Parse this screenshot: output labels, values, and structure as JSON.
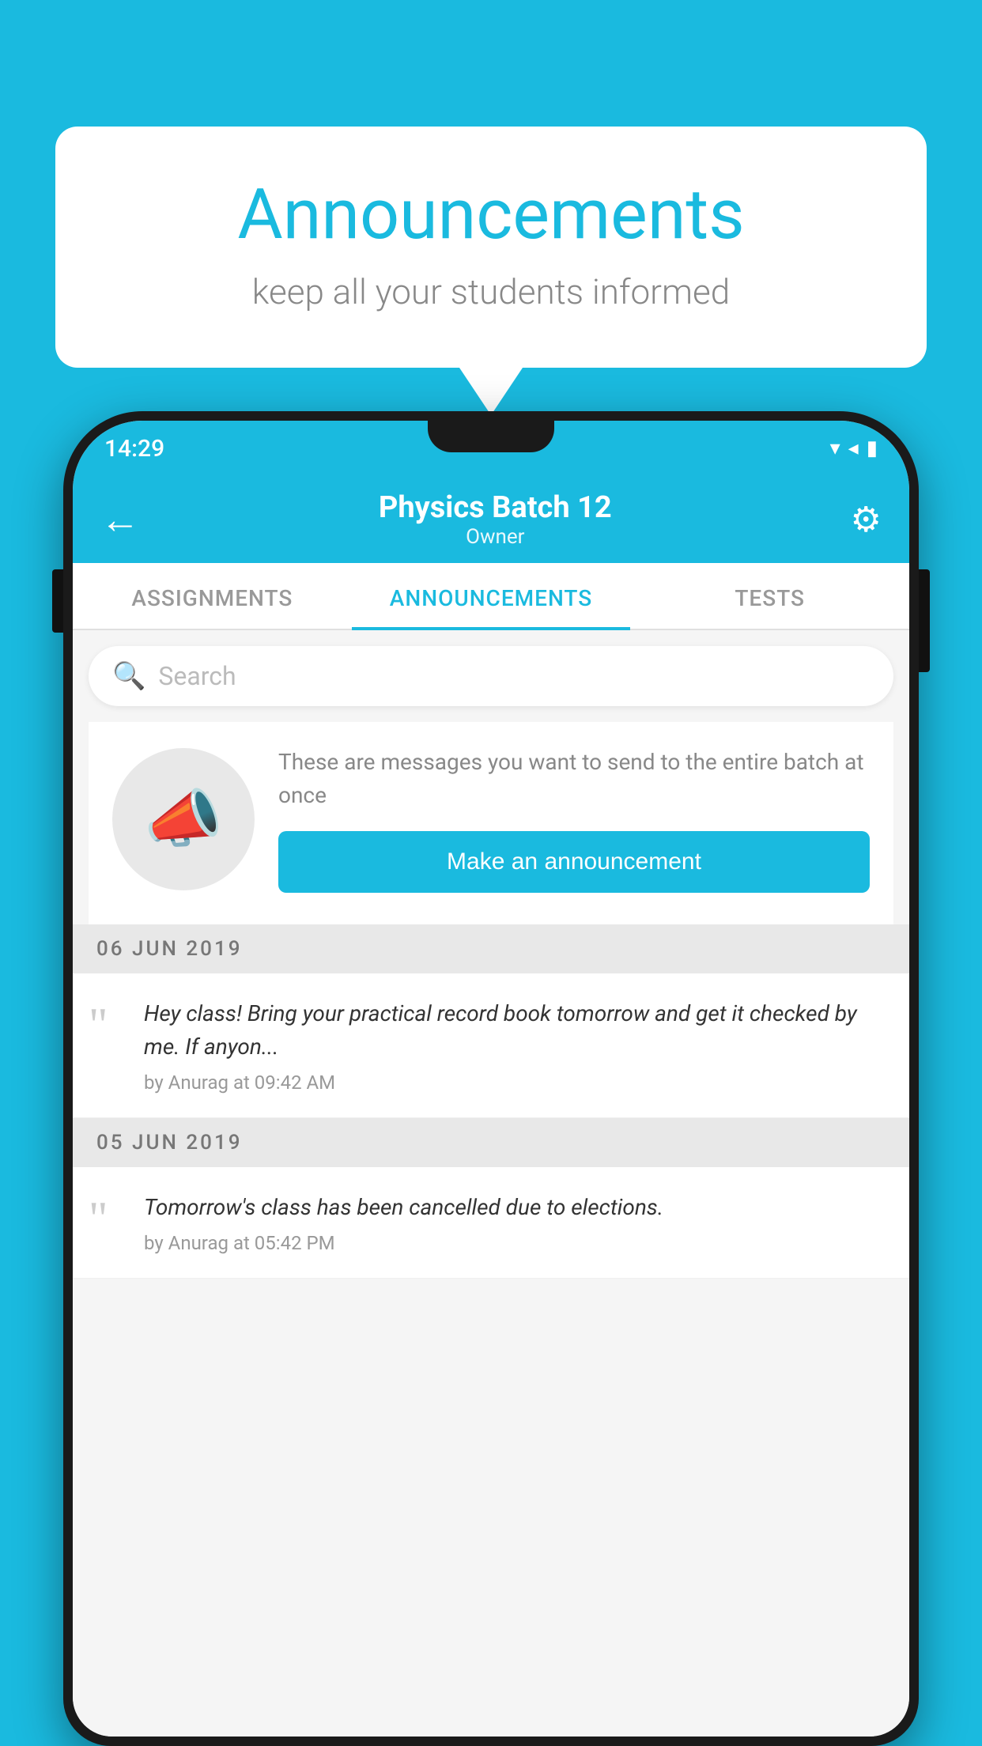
{
  "page": {
    "background_color": "#1ABADF"
  },
  "speech_bubble": {
    "title": "Announcements",
    "subtitle": "keep all your students informed"
  },
  "phone": {
    "status_bar": {
      "time": "14:29",
      "icons": "▾◂▮"
    },
    "header": {
      "title": "Physics Batch 12",
      "subtitle": "Owner",
      "back_label": "←",
      "gear_label": "⚙"
    },
    "tabs": [
      {
        "label": "ASSIGNMENTS",
        "active": false
      },
      {
        "label": "ANNOUNCEMENTS",
        "active": true
      },
      {
        "label": "TESTS",
        "active": false
      },
      {
        "label": "...",
        "active": false
      }
    ],
    "search": {
      "placeholder": "Search"
    },
    "empty_state": {
      "description": "These are messages you want to send to the entire batch at once",
      "button_label": "Make an announcement",
      "icon": "📣"
    },
    "announcements": [
      {
        "date": "06  JUN  2019",
        "text": "Hey class! Bring your practical record book tomorrow and get it checked by me. If anyon...",
        "meta": "by Anurag at 09:42 AM"
      },
      {
        "date": "05  JUN  2019",
        "text": "Tomorrow's class has been cancelled due to elections.",
        "meta": "by Anurag at 05:42 PM"
      }
    ]
  }
}
